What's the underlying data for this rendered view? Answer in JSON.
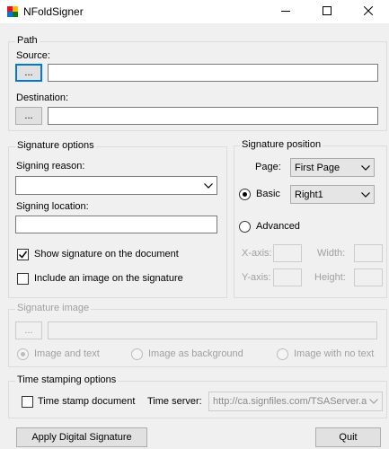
{
  "window": {
    "title": "NFoldSigner",
    "minimize_icon": "minimize-icon",
    "maximize_icon": "maximize-icon",
    "close_icon": "close-icon"
  },
  "path": {
    "group_label": "Path",
    "source_label": "Source:",
    "source_button": "...",
    "source_value": "",
    "destination_label": "Destination:",
    "destination_button": "...",
    "destination_value": ""
  },
  "signature_options": {
    "group_label": "Signature options",
    "signing_reason_label": "Signing reason:",
    "signing_reason_value": "",
    "signing_location_label": "Signing location:",
    "signing_location_value": "",
    "show_signature_label": "Show signature on the document",
    "show_signature_checked": true,
    "include_image_label": "Include an image on the signature",
    "include_image_checked": false
  },
  "signature_position": {
    "group_label": "Signature position",
    "page_label": "Page:",
    "page_value": "First Page",
    "basic_label": "Basic",
    "basic_selected": true,
    "basic_value": "Right1",
    "advanced_label": "Advanced",
    "advanced_selected": false,
    "xaxis_label": "X-axis:",
    "yaxis_label": "Y-axis:",
    "width_label": "Width:",
    "height_label": "Height:"
  },
  "signature_image": {
    "group_label": "Signature image",
    "browse_button": "...",
    "image_path": "",
    "radio_image_and_text": "Image and text",
    "radio_image_background": "Image as background",
    "radio_image_no_text": "Image with no text"
  },
  "time_stamping": {
    "group_label": "Time stamping options",
    "timestamp_label": "Time stamp document",
    "timestamp_checked": false,
    "time_server_label": "Time server:",
    "time_server_value": "http://ca.signfiles.com/TSAServer.a"
  },
  "footer": {
    "apply_button": "Apply Digital Signature",
    "quit_button": "Quit"
  }
}
